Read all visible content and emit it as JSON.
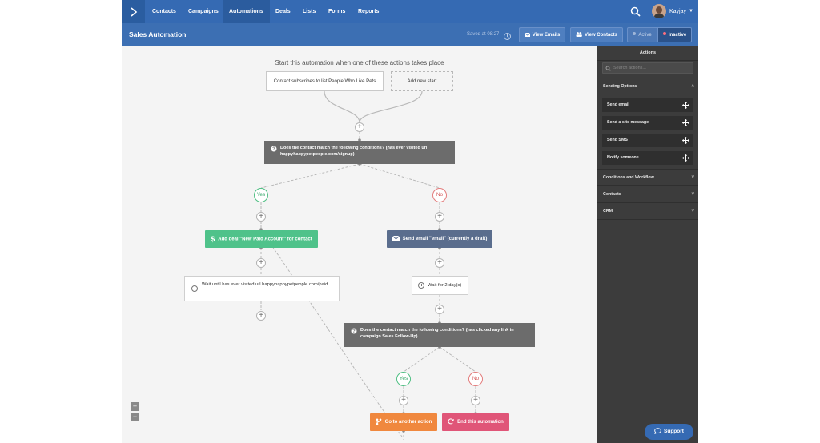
{
  "nav": {
    "items": [
      {
        "label": "Contacts"
      },
      {
        "label": "Campaigns"
      },
      {
        "label": "Automations"
      },
      {
        "label": "Deals"
      },
      {
        "label": "Lists"
      },
      {
        "label": "Forms"
      },
      {
        "label": "Reports"
      }
    ],
    "active": "Automations",
    "user_name": "Kayjay",
    "icons": {
      "logo": "chevron-right-logo-icon",
      "search": "search-icon",
      "user_menu": "caret-down-icon"
    }
  },
  "header": {
    "title": "Sales Automation",
    "saved_text": "Saved at 08:27",
    "view_emails_label": "View Emails",
    "view_contacts_label": "View Contacts",
    "active_label": "Active",
    "inactive_label": "Inactive",
    "icons": {
      "history": "history-icon",
      "emails": "email-icon",
      "contacts": "users-icon"
    }
  },
  "canvas": {
    "start_heading": "Start this automation when one of these actions takes place",
    "start_trigger": "Contact subscribes to list People Who Like Pets",
    "add_new_start": "Add new start",
    "condition_1": "Does the contact match the following conditions? (has ever visited url happyhappypetpeople.com/signup)",
    "yes_label": "Yes",
    "no_label": "No",
    "add_deal": "Add deal \"New Paid Account\" for contact",
    "send_email": "Send email \"email\" (currently a draft)",
    "wait_until": "Wait until has ever visited url happyhappypetpeople.com/paid",
    "wait_for": "Wait for 2 day(s)",
    "condition_2": "Does the contact match the following conditions? (has clicked any link in campaign Sales Follow-Up)",
    "yes_label_2": "Yes",
    "no_label_2": "No",
    "goto_action": "Go to another action",
    "end_automation": "End this automation",
    "plus": "+",
    "zoom_in": "+",
    "zoom_out": "−",
    "colors": {
      "condition": "#6c6c6c",
      "yes": "#4fbf83",
      "no": "#e37c7c",
      "deal_action": "#4fc28a",
      "email_action": "#5a6d8d",
      "goto_action": "#f0883e",
      "end_action": "#e05578"
    }
  },
  "panel": {
    "title": "Actions",
    "search_placeholder": "Search actions...",
    "sections": [
      {
        "label": "Sending Options",
        "expanded": true
      },
      {
        "label": "Conditions and Workflow",
        "expanded": false
      },
      {
        "label": "Contacts",
        "expanded": false
      },
      {
        "label": "CRM",
        "expanded": false
      }
    ],
    "sending_items": [
      {
        "label": "Send email"
      },
      {
        "label": "Send a site message"
      },
      {
        "label": "Send SMS"
      },
      {
        "label": "Notify someone"
      }
    ]
  },
  "support": {
    "label": "Support",
    "icon": "chat-bubble-icon"
  }
}
